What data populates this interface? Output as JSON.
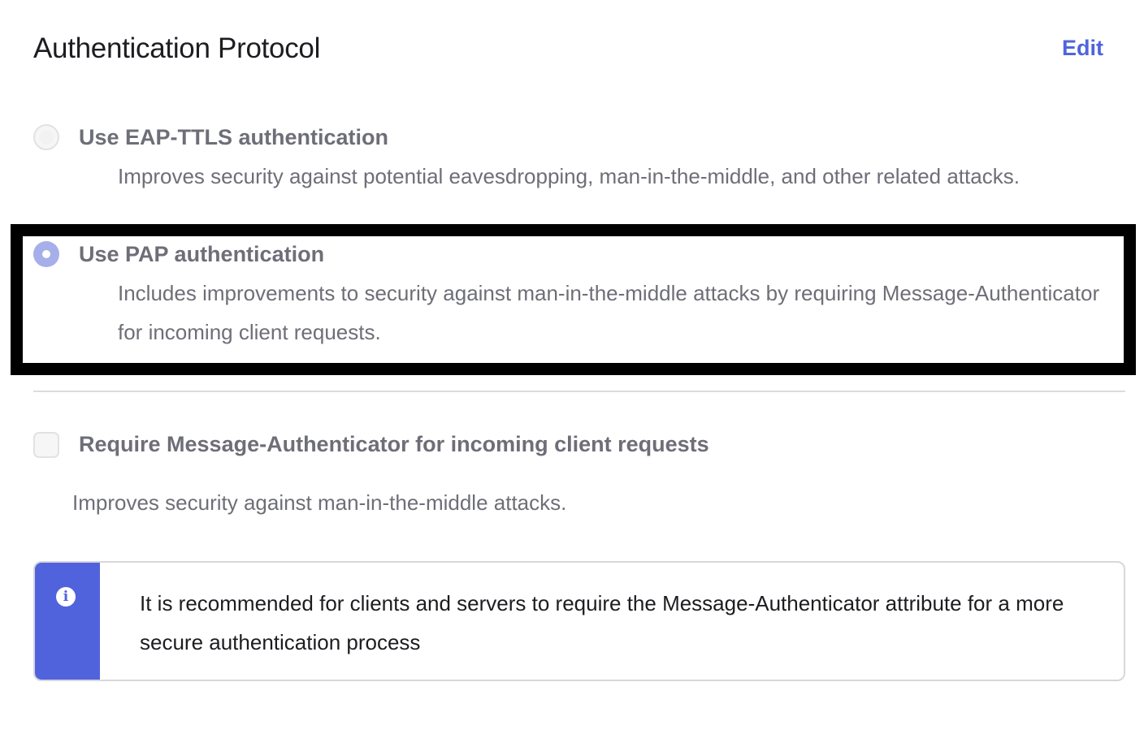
{
  "header": {
    "title": "Authentication Protocol",
    "edit_label": "Edit"
  },
  "protocol_options": [
    {
      "label": "Use EAP-TTLS authentication",
      "description": "Improves security against potential eavesdropping, man-in-the-middle, and other related attacks.",
      "selected": false
    },
    {
      "label": "Use PAP authentication",
      "description": "Includes improvements to security against man-in-the-middle attacks by requiring Message-Authenticator for incoming client requests.",
      "selected": true
    }
  ],
  "message_authenticator": {
    "label": "Require Message-Authenticator for incoming client requests",
    "description": "Improves security against man-in-the-middle attacks.",
    "checked": false
  },
  "callout": {
    "icon": "info-icon",
    "text": "It is recommended for clients and servers to require the Message-Authenticator attribute for a more secure authentication process"
  },
  "colors": {
    "accent": "#4f64de",
    "callout_stripe": "#5063dc",
    "selected_radio": "#a6afe9",
    "muted_text": "#6e6e78"
  }
}
